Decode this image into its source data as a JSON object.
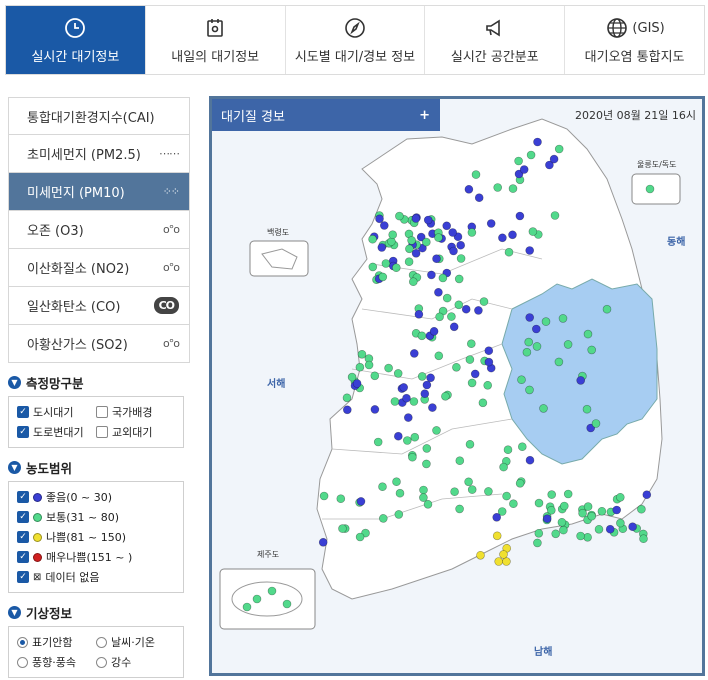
{
  "tabs": [
    {
      "label": "실시간 대기정보",
      "icon": "clock-icon",
      "active": true
    },
    {
      "label": "내일의 대기정보",
      "icon": "calendar-icon"
    },
    {
      "label": "시도별 대기/경보 정보",
      "icon": "compass-icon"
    },
    {
      "label": "실시간 공간분포",
      "icon": "megaphone-icon"
    },
    {
      "label": "대기오염 통합지도",
      "icon": "globe-icon",
      "prefix": "(GIS)"
    }
  ],
  "sidebar": {
    "items": [
      {
        "label": "통합대기환경지수(CAI)",
        "icon": ""
      },
      {
        "label": "초미세먼지 (PM2.5)",
        "icon": "⋯⋯"
      },
      {
        "label": "미세먼지 (PM10)",
        "icon": "⁘⁘"
      },
      {
        "label": "오존 (O3)",
        "icon": "o°o"
      },
      {
        "label": "이산화질소 (NO2)",
        "icon": "o°o"
      },
      {
        "label": "일산화탄소 (CO)",
        "icon": "CO"
      },
      {
        "label": "아황산가스 (SO2)",
        "icon": "o°o"
      }
    ],
    "sections": {
      "network": {
        "title": "측정망구분",
        "options": [
          {
            "label": "도시대기",
            "checked": true
          },
          {
            "label": "국가배경",
            "checked": false
          },
          {
            "label": "도로변대기",
            "checked": true
          },
          {
            "label": "교외대기",
            "checked": false
          }
        ]
      },
      "range": {
        "title": "농도범위",
        "items": [
          {
            "label": "좋음(0 ~ 30)",
            "color": "#3a3fd4",
            "checked": true
          },
          {
            "label": "보통(31 ~ 80)",
            "color": "#52d98b",
            "checked": true
          },
          {
            "label": "나쁨(81 ~ 150)",
            "color": "#f0e030",
            "checked": true
          },
          {
            "label": "매우나쁨(151 ~ )",
            "color": "#d02020",
            "checked": true
          },
          {
            "label": "데이터 없음",
            "color": "",
            "checked": true
          }
        ]
      },
      "weather": {
        "title": "기상정보",
        "options": [
          {
            "label": "표기안함",
            "selected": true
          },
          {
            "label": "날씨·기온",
            "selected": false
          },
          {
            "label": "풍향·풍속",
            "selected": false
          },
          {
            "label": "강수",
            "selected": false
          }
        ]
      }
    }
  },
  "map": {
    "header_title": "대기질 경보",
    "header_plus": "+",
    "date": "2020년 08월 21일 16시",
    "labels": {
      "baengnyeong": "백령도",
      "ulleung": "울릉도/독도",
      "east_sea": "동해",
      "west_sea": "서해",
      "south_sea": "남해",
      "jeju": "제주도"
    },
    "colors": {
      "good": "#3a3fd4",
      "normal": "#52d98b",
      "bad": "#f0e030",
      "alert_region": "#a7cdf2"
    }
  }
}
